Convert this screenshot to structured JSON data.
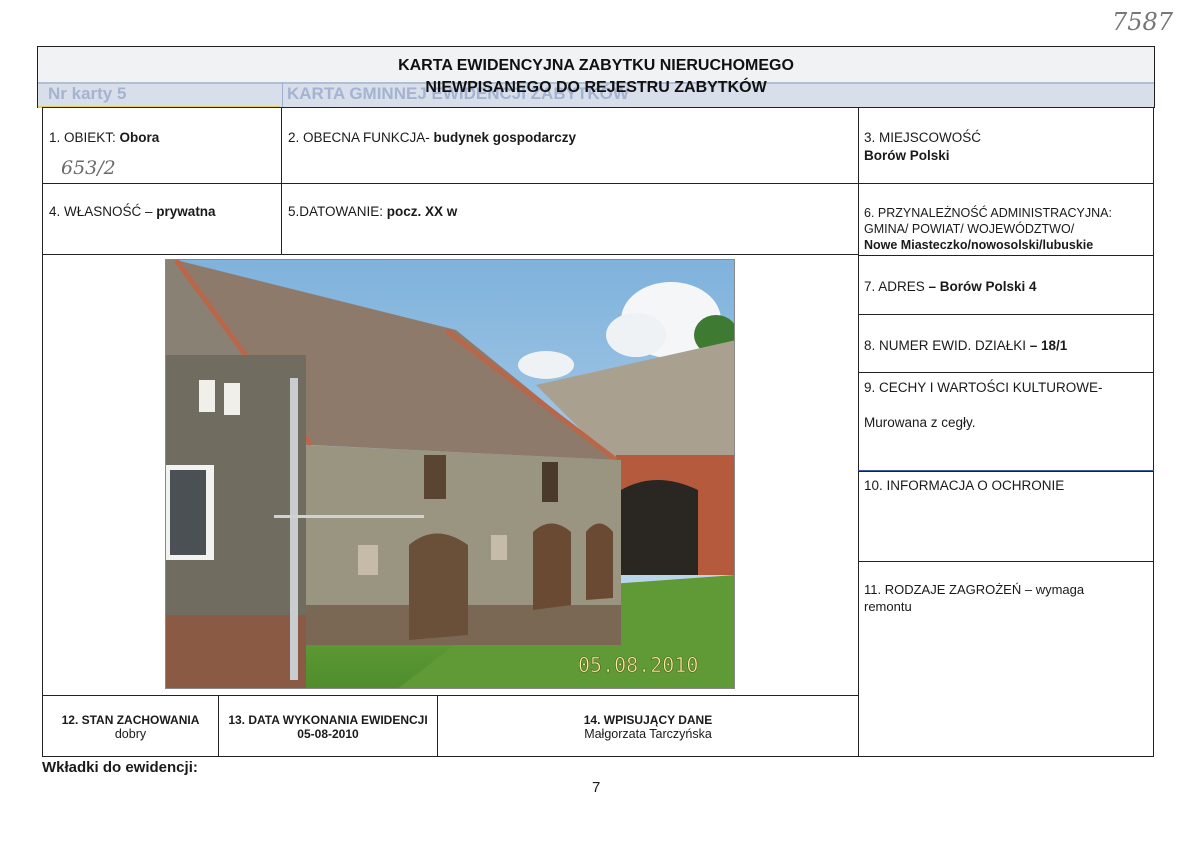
{
  "stamp_number": "7587",
  "card": {
    "title_line1": "KARTA EWIDENCYJNA ZABYTKU NIERUCHOMEGO",
    "title_line2": "NIEWPISANEGO DO REJESTRU ZABYTKÓW",
    "ghost_left": "Nr karty 5",
    "ghost_right": "KARTA GMINNEJ EWIDENCJI ZABYTKÓW"
  },
  "fields": {
    "obiekt": {
      "label": "1. OBIEKT: ",
      "value": "Obora",
      "handwritten": "653/2"
    },
    "funkcja": {
      "label": "2. OBECNA FUNKCJA- ",
      "value": "budynek gospodarczy"
    },
    "miejscowosc": {
      "label": "3. MIEJSCOWOŚĆ",
      "value": "Borów Polski"
    },
    "wlasnosc": {
      "label": "4. WŁASNOŚĆ – ",
      "value": "prywatna"
    },
    "datowanie": {
      "label": "5.DATOWANIE: ",
      "value": "pocz. XX w"
    },
    "przynaleznosc": {
      "label1": "6. PRZYNALEŻNOŚĆ ADMINISTRACYJNA:",
      "label2": "GMINA/ POWIAT/ WOJEWÓDZTWO/",
      "value": "Nowe Miasteczko/nowosolski/lubuskie"
    },
    "adres": {
      "label": "7. ADRES ",
      "value": "– Borów Polski 4"
    },
    "dzialka": {
      "label": "8. NUMER EWID. DZIAŁKI ",
      "value": "– 18/1"
    },
    "cechy": {
      "label": "9. CECHY  I WARTOŚCI KULTUROWE-",
      "value": "Murowana z cegły."
    },
    "ochrona": {
      "label": "10. INFORMACJA O OCHRONIE"
    },
    "zagrozenia": {
      "label": "11. RODZAJE ZAGROŻEŃ – ",
      "value": "wymaga remontu"
    },
    "stan": {
      "label": "12. STAN ZACHOWANIA",
      "value": "dobry"
    },
    "data": {
      "label": "13. DATA WYKONANIA EWIDENCJI",
      "value": "05-08-2010"
    },
    "wpisujacy": {
      "label": "14. WPISUJĄCY DANE",
      "value": "Małgorzata Tarczyńska"
    }
  },
  "photo": {
    "date_stamp": "05.08.2010"
  },
  "footer": {
    "inserts_label": "Wkładki do ewidencji:",
    "page_number": "7"
  }
}
